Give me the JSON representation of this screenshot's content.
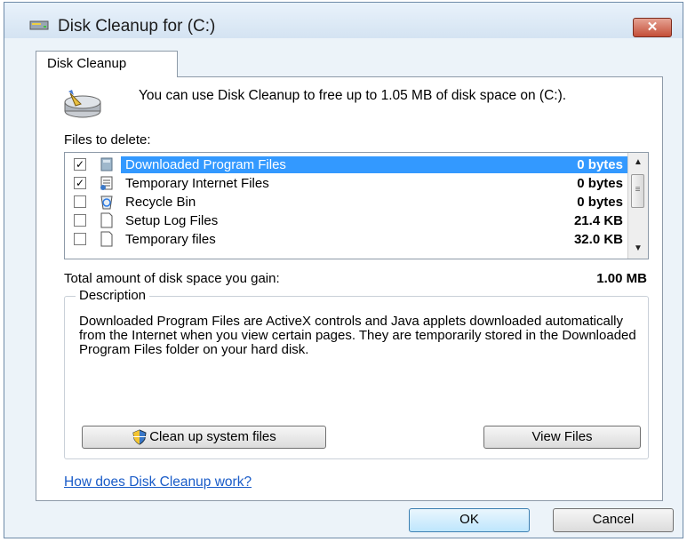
{
  "window": {
    "title": "Disk Cleanup for  (C:)",
    "close_label": "✕"
  },
  "tab": {
    "label": "Disk Cleanup"
  },
  "intro": {
    "text": "You can use Disk Cleanup to free up to 1.05 MB of disk space on  (C:)."
  },
  "files": {
    "label": "Files to delete:",
    "items": [
      {
        "name": "Downloaded Program Files",
        "size": "0 bytes",
        "checked": true,
        "selected": true
      },
      {
        "name": "Temporary Internet Files",
        "size": "0 bytes",
        "checked": true,
        "selected": false
      },
      {
        "name": "Recycle Bin",
        "size": "0 bytes",
        "checked": false,
        "selected": false
      },
      {
        "name": "Setup Log Files",
        "size": "21.4 KB",
        "checked": false,
        "selected": false
      },
      {
        "name": "Temporary files",
        "size": "32.0 KB",
        "checked": false,
        "selected": false
      }
    ]
  },
  "total": {
    "label": "Total amount of disk space you gain:",
    "value": "1.00 MB"
  },
  "description": {
    "legend": "Description",
    "text": "Downloaded Program Files are ActiveX controls and Java applets downloaded automatically from the Internet when you view certain pages. They are temporarily stored in the Downloaded Program Files folder on your hard disk."
  },
  "buttons": {
    "cleanup_system": "Clean up system files",
    "view_files": "View Files",
    "ok": "OK",
    "cancel": "Cancel"
  },
  "help_link": "How does Disk Cleanup work?",
  "colors": {
    "selection": "#3399ff",
    "link": "#1a5cc8",
    "close_button": "#c44e38"
  }
}
